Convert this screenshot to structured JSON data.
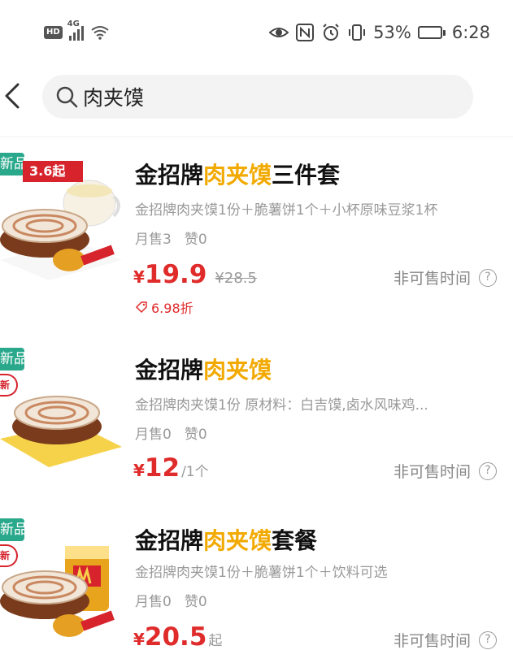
{
  "status_bar": {
    "hd": "HD",
    "network": "4G",
    "battery_percent": "53%",
    "battery_level": 0.53,
    "time": "6:28",
    "icons": [
      "eye-icon",
      "nfc-icon",
      "alarm-icon",
      "vibrate-icon",
      "battery-icon"
    ]
  },
  "search": {
    "query": "肉夹馍",
    "back_icon": "chevron-left-icon",
    "search_icon": "search-icon"
  },
  "products": [
    {
      "badge": "新品",
      "price_badge": "3.6起",
      "title_pre": "金招牌",
      "title_highlight": "肉夹馍",
      "title_post": "三件套",
      "description": "金招牌肉夹馍1份＋脆薯饼1个＋小杯原味豆浆1杯",
      "monthly_sales": "月售3",
      "likes": "赞0",
      "currency": "¥",
      "price": "19.9",
      "price_unit": "",
      "original_price": "¥28.5",
      "discount": "6.98折",
      "availability": "非可售时间"
    },
    {
      "badge": "新品",
      "new_stamp": "新",
      "title_pre": "金招牌",
      "title_highlight": "肉夹馍",
      "title_post": "",
      "description": "金招牌肉夹馍1份 原材料：白吉馍,卤水风味鸡...",
      "monthly_sales": "月售0",
      "likes": "赞0",
      "currency": "¥",
      "price": "12",
      "price_unit": "/1个",
      "availability": "非可售时间"
    },
    {
      "badge": "新品",
      "new_stamp": "新",
      "title_pre": "金招牌",
      "title_highlight": "肉夹馍",
      "title_post": "套餐",
      "description": "金招牌肉夹馍1份＋脆薯饼1个＋饮料可选",
      "monthly_sales": "月售0",
      "likes": "赞0",
      "currency": "¥",
      "price": "20.5",
      "price_unit": "起",
      "availability": "非可售时间"
    }
  ]
}
